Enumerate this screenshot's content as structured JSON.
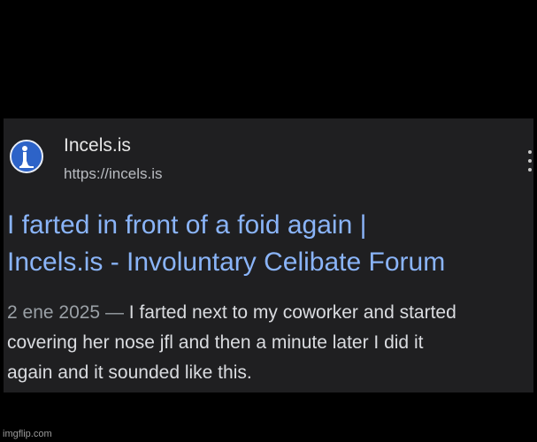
{
  "result": {
    "site_name": "Incels.is",
    "site_url": "https://incels.is",
    "favicon_icon": "person-silhouette-icon",
    "title_lines": [
      "I farted in front of a foid again |",
      "Incels.is - Involuntary Celibate Forum"
    ],
    "snippet_date": "2 ene 2025",
    "snippet_separator": " — ",
    "snippet_lines": [
      "I farted next to my coworker and started",
      "covering her nose jfl and then a minute later I did it",
      "again and it sounded like this."
    ],
    "menu_icon": "more-vert-icon"
  },
  "watermark": "imgflip.com",
  "colors": {
    "background": "#000000",
    "card": "#1f1f21",
    "title_link": "#8ab4f8",
    "favicon": "#2d63c8"
  }
}
